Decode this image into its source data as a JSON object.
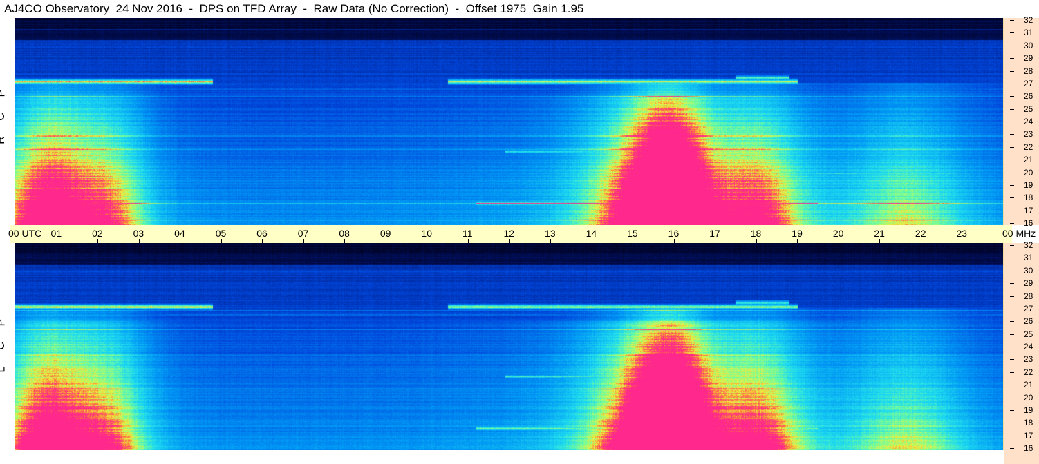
{
  "title": "AJ4CO Observatory  24 Nov 2016  -  DPS on TFD Array  -  Raw Data (No Correction)  -  Offset 1975  Gain 1.95",
  "panels": [
    {
      "label_chars": [
        "P",
        "C",
        "R"
      ]
    },
    {
      "label_chars": [
        "P",
        "C",
        "L"
      ]
    }
  ],
  "chart_data": {
    "type": "heatmap",
    "title": "AJ4CO Observatory  24 Nov 2016  -  DPS on TFD Array  -  Raw Data (No Correction)  -  Offset 1975  Gain 1.95",
    "x_label_start": "00 UTC",
    "x_label_end": "00 MHz",
    "x_ticks": [
      "01",
      "02",
      "03",
      "04",
      "05",
      "06",
      "07",
      "08",
      "09",
      "10",
      "11",
      "12",
      "13",
      "14",
      "15",
      "16",
      "17",
      "18",
      "19",
      "20",
      "21",
      "22",
      "23"
    ],
    "x_range_hours": [
      0,
      24
    ],
    "y_ticks": [
      "32",
      "31",
      "30",
      "29",
      "28",
      "27",
      "26",
      "25",
      "24",
      "23",
      "22",
      "21",
      "20",
      "19",
      "18",
      "17",
      "16"
    ],
    "y_range_mhz": [
      16,
      32
    ],
    "series": [
      {
        "name": "R C P"
      },
      {
        "name": "L C P"
      }
    ],
    "features": [
      {
        "freq_mhz": 27.1,
        "t_start": 0.0,
        "t_end": 4.8,
        "intensity": 0.95
      },
      {
        "freq_mhz": 27.1,
        "t_start": 10.5,
        "t_end": 19.0,
        "intensity": 0.9
      },
      {
        "freq_mhz": 27.4,
        "t_start": 17.5,
        "t_end": 18.8,
        "intensity": 0.8
      },
      {
        "freq_mhz": 21.7,
        "t_start": 11.9,
        "t_end": 17.0,
        "intensity": 0.75
      },
      {
        "freq_mhz": 17.7,
        "t_start": 11.2,
        "t_end": 19.5,
        "intensity": 0.85
      },
      {
        "freq_mhz": 20.0,
        "t_start": 15.9,
        "t_end": 22.8,
        "intensity": 0.7
      },
      {
        "freq_mhz": 17.1,
        "t_start": 11.5,
        "t_end": 24.0,
        "intensity": 0.55
      },
      {
        "freq_mhz": 26.5,
        "t_start": 0.0,
        "t_end": 24.0,
        "intensity": 0.45
      },
      {
        "freq_mhz": 29.8,
        "t_start": 0.0,
        "t_end": 24.0,
        "intensity": 0.35
      }
    ],
    "enhancements": [
      {
        "t_center": 0.7,
        "width_h": 1.2,
        "strength": 0.55
      },
      {
        "t_center": 2.4,
        "width_h": 1.0,
        "strength": 0.35
      },
      {
        "t_center": 15.2,
        "width_h": 1.6,
        "strength": 0.45
      },
      {
        "t_center": 16.0,
        "width_h": 1.0,
        "strength": 0.5
      },
      {
        "t_center": 18.1,
        "width_h": 1.2,
        "strength": 0.45
      },
      {
        "t_center": 21.7,
        "width_h": 1.6,
        "strength": 0.35
      }
    ],
    "colors": {
      "low": "#000020",
      "mid": "#0050e0",
      "high": "#30e0ff",
      "peak": "#ff2080"
    }
  }
}
